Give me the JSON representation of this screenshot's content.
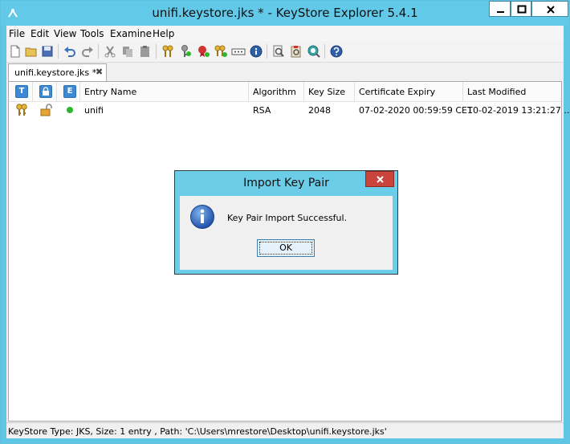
{
  "window": {
    "title": "unifi.keystore.jks * - KeyStore Explorer 5.4.1"
  },
  "menu": {
    "items": [
      "File",
      "Edit",
      "View",
      "Tools",
      "Examine",
      "Help"
    ]
  },
  "toolbar": {
    "icons": [
      "new-icon",
      "open-icon",
      "save-icon",
      "undo-icon",
      "redo-icon",
      "cut-icon",
      "copy-icon",
      "paste-icon",
      "generate-key-pair-icon",
      "generate-secret-key-icon",
      "import-trusted-certificate-icon",
      "import-key-pair-icon",
      "set-password-icon",
      "properties-icon",
      "examine-file-icon",
      "examine-clipboard-icon",
      "examine-ssl-icon",
      "help-icon"
    ]
  },
  "tab": {
    "label": "unifi.keystore.jks *",
    "close": "✖"
  },
  "table": {
    "header_icons": [
      "T",
      "L",
      "E"
    ],
    "columns": [
      "Entry Name",
      "Algorithm",
      "Key Size",
      "Certificate Expiry",
      "Last Modified"
    ],
    "rows": [
      {
        "entry_name": "unifi",
        "algorithm": "RSA",
        "key_size": "2048",
        "certificate_expiry": "07-02-2020 00:59:59 CET",
        "last_modified": "10-02-2019 13:21:27 ..."
      }
    ]
  },
  "status": {
    "text": "KeyStore Type: JKS, Size: 1 entry , Path: 'C:\\Users\\mrestore\\Desktop\\unifi.keystore.jks'"
  },
  "dialog": {
    "title": "Import Key Pair",
    "message": "Key Pair Import Successful.",
    "ok_label": "OK"
  },
  "colors": {
    "title_bar": "#62c9e9",
    "close_button": "#c8443c",
    "status_ok": "#2db52d"
  }
}
